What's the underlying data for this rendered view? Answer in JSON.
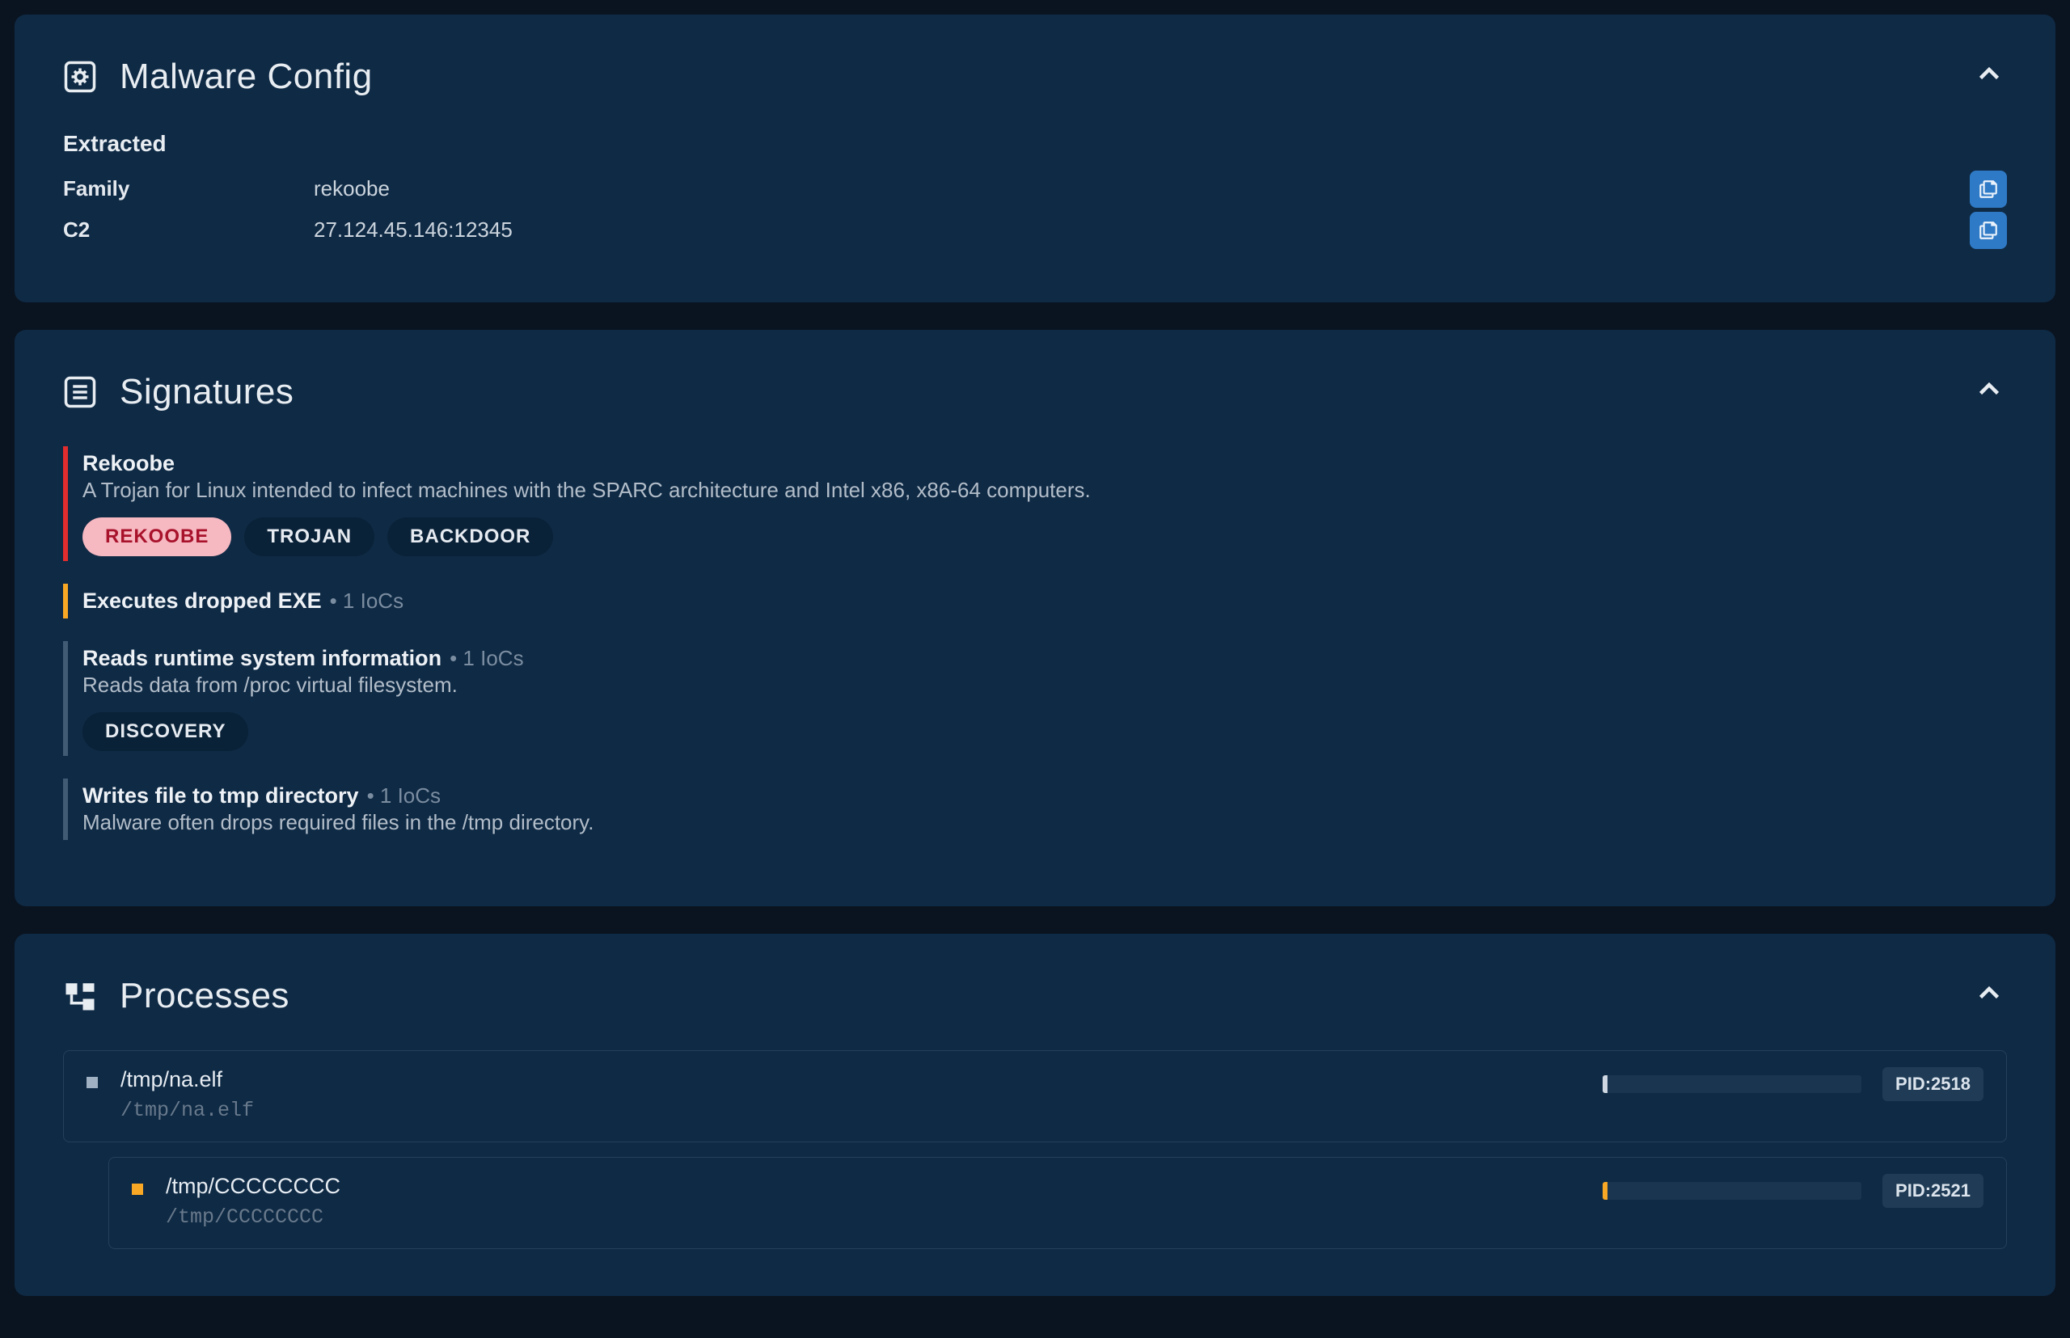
{
  "malware_config": {
    "title": "Malware Config",
    "extracted_label": "Extracted",
    "rows": [
      {
        "key": "Family",
        "value": "rekoobe"
      },
      {
        "key": "C2",
        "value": "27.124.45.146:12345"
      }
    ]
  },
  "signatures": {
    "title": "Signatures",
    "items": [
      {
        "severity": "red",
        "title": "Rekoobe",
        "iocs": "",
        "desc": "A Trojan for Linux intended to infect machines with the SPARC architecture and Intel x86, x86-64 computers.",
        "tags": [
          {
            "label": "REKOOBE",
            "highlight": true
          },
          {
            "label": "TROJAN",
            "highlight": false
          },
          {
            "label": "BACKDOOR",
            "highlight": false
          }
        ]
      },
      {
        "severity": "orange",
        "title": "Executes dropped EXE",
        "iocs": "• 1 IoCs",
        "desc": "",
        "tags": []
      },
      {
        "severity": "faint",
        "title": "Reads runtime system information",
        "iocs": "• 1 IoCs",
        "desc": "Reads data from /proc virtual filesystem.",
        "tags": [
          {
            "label": "DISCOVERY",
            "highlight": false
          }
        ]
      },
      {
        "severity": "faint",
        "title": "Writes file to tmp directory",
        "iocs": "• 1 IoCs",
        "desc": "Malware often drops required files in the /tmp directory.",
        "tags": []
      }
    ]
  },
  "processes": {
    "title": "Processes",
    "items": [
      {
        "indent": 0,
        "marker": "white",
        "path": "/tmp/na.elf",
        "path_sub": "/tmp/na.elf",
        "bar_tick": "white",
        "pid": "PID:2518"
      },
      {
        "indent": 1,
        "marker": "orange",
        "path": "/tmp/CCCCCCCC",
        "path_sub": "/tmp/CCCCCCCC",
        "bar_tick": "orange",
        "pid": "PID:2521"
      }
    ]
  }
}
